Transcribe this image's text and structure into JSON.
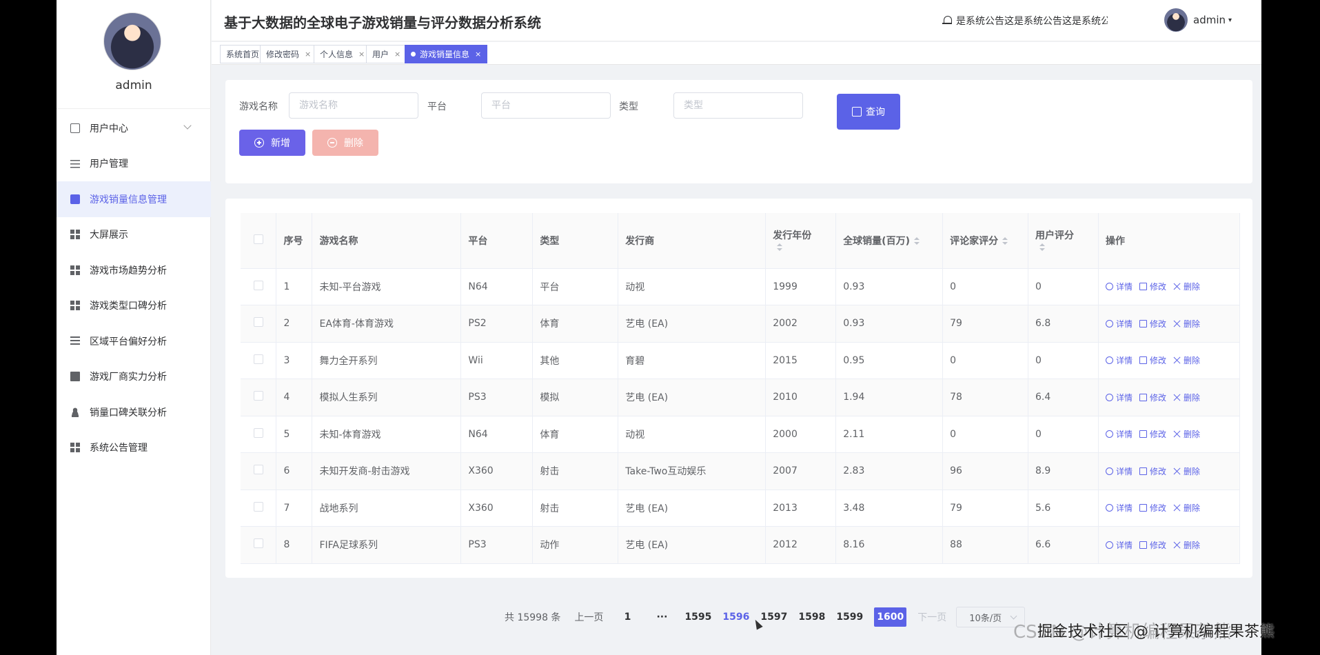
{
  "sidebar": {
    "username": "admin",
    "items": [
      {
        "label": "用户中心",
        "icon": "panel-icon",
        "active": false
      },
      {
        "label": "用户管理",
        "icon": "sliders-icon",
        "active": false
      },
      {
        "label": "游戏销量信息管理",
        "icon": "briefcase-icon",
        "active": true
      },
      {
        "label": "大屏展示",
        "icon": "grid-icon",
        "active": false
      },
      {
        "label": "游戏市场趋势分析",
        "icon": "grid-icon",
        "active": false
      },
      {
        "label": "游戏类型口碑分析",
        "icon": "grid-icon",
        "active": false
      },
      {
        "label": "区域平台偏好分析",
        "icon": "list-icon",
        "active": false
      },
      {
        "label": "游戏厂商实力分析",
        "icon": "chart-icon",
        "active": false
      },
      {
        "label": "销量口碑关联分析",
        "icon": "user-icon",
        "active": false
      },
      {
        "label": "系统公告管理",
        "icon": "grid-icon",
        "active": false
      }
    ]
  },
  "header": {
    "title": "基于大数据的全球电子游戏销量与评分数据分析系统",
    "notice": "是系统公告这是系统公告这是系统公告这是",
    "user": "admin"
  },
  "tabs": [
    {
      "label": "系统首页"
    },
    {
      "label": "修改密码"
    },
    {
      "label": "个人信息"
    },
    {
      "label": "用户"
    },
    {
      "label": "游戏销量信息"
    }
  ],
  "search": {
    "name_label": "游戏名称",
    "name_placeholder": "游戏名称",
    "platform_label": "平台",
    "platform_placeholder": "平台",
    "type_label": "类型",
    "type_placeholder": "类型",
    "query_button": "查询",
    "add_button": "新增",
    "delete_button": "删除"
  },
  "table": {
    "headers": {
      "index": "序号",
      "name": "游戏名称",
      "platform": "平台",
      "type": "类型",
      "publisher": "发行商",
      "year": "发行年份",
      "sales": "全球销量(百万)",
      "critic": "评论家评分",
      "user_score": "用户评分",
      "actions": "操作"
    },
    "action_labels": {
      "detail": "详情",
      "edit": "修改",
      "delete": "删除"
    },
    "rows": [
      {
        "index": "1",
        "name": "未知-平台游戏",
        "platform": "N64",
        "type": "平台",
        "publisher": "动视",
        "year": "1999",
        "sales": "0.93",
        "critic": "0",
        "user_score": "0"
      },
      {
        "index": "2",
        "name": "EA体育-体育游戏",
        "platform": "PS2",
        "type": "体育",
        "publisher": "艺电 (EA)",
        "year": "2002",
        "sales": "0.93",
        "critic": "79",
        "user_score": "6.8"
      },
      {
        "index": "3",
        "name": "舞力全开系列",
        "platform": "Wii",
        "type": "其他",
        "publisher": "育碧",
        "year": "2015",
        "sales": "0.95",
        "critic": "0",
        "user_score": "0"
      },
      {
        "index": "4",
        "name": "模拟人生系列",
        "platform": "PS3",
        "type": "模拟",
        "publisher": "艺电 (EA)",
        "year": "2010",
        "sales": "1.94",
        "critic": "78",
        "user_score": "6.4"
      },
      {
        "index": "5",
        "name": "未知-体育游戏",
        "platform": "N64",
        "type": "体育",
        "publisher": "动视",
        "year": "2000",
        "sales": "2.11",
        "critic": "0",
        "user_score": "0"
      },
      {
        "index": "6",
        "name": "未知开发商-射击游戏",
        "platform": "X360",
        "type": "射击",
        "publisher": "Take-Two互动娱乐",
        "year": "2007",
        "sales": "2.83",
        "critic": "96",
        "user_score": "8.9"
      },
      {
        "index": "7",
        "name": "战地系列",
        "platform": "X360",
        "type": "射击",
        "publisher": "艺电 (EA)",
        "year": "2013",
        "sales": "3.48",
        "critic": "79",
        "user_score": "5.6"
      },
      {
        "index": "8",
        "name": "FIFA足球系列",
        "platform": "PS3",
        "type": "动作",
        "publisher": "艺电 (EA)",
        "year": "2012",
        "sales": "8.16",
        "critic": "88",
        "user_score": "6.6"
      }
    ]
  },
  "pagination": {
    "total_text": "共 15998 条",
    "prev": "上一页",
    "first": "1",
    "ellipsis": "···",
    "pages": [
      "1595",
      "1596",
      "1597",
      "1598",
      "1599",
      "1600"
    ],
    "active_page": "1600",
    "hover_page": "1596",
    "next": "下一页",
    "page_size": "10条/页"
  },
  "watermark": "CSDN @计算机编程果茶熊",
  "watermark_overlay": "掘金技术社区 @ 计算机编程果茶熊",
  "colors": {
    "accent": "#5b62e7",
    "danger_light": "#f4b4ae"
  }
}
